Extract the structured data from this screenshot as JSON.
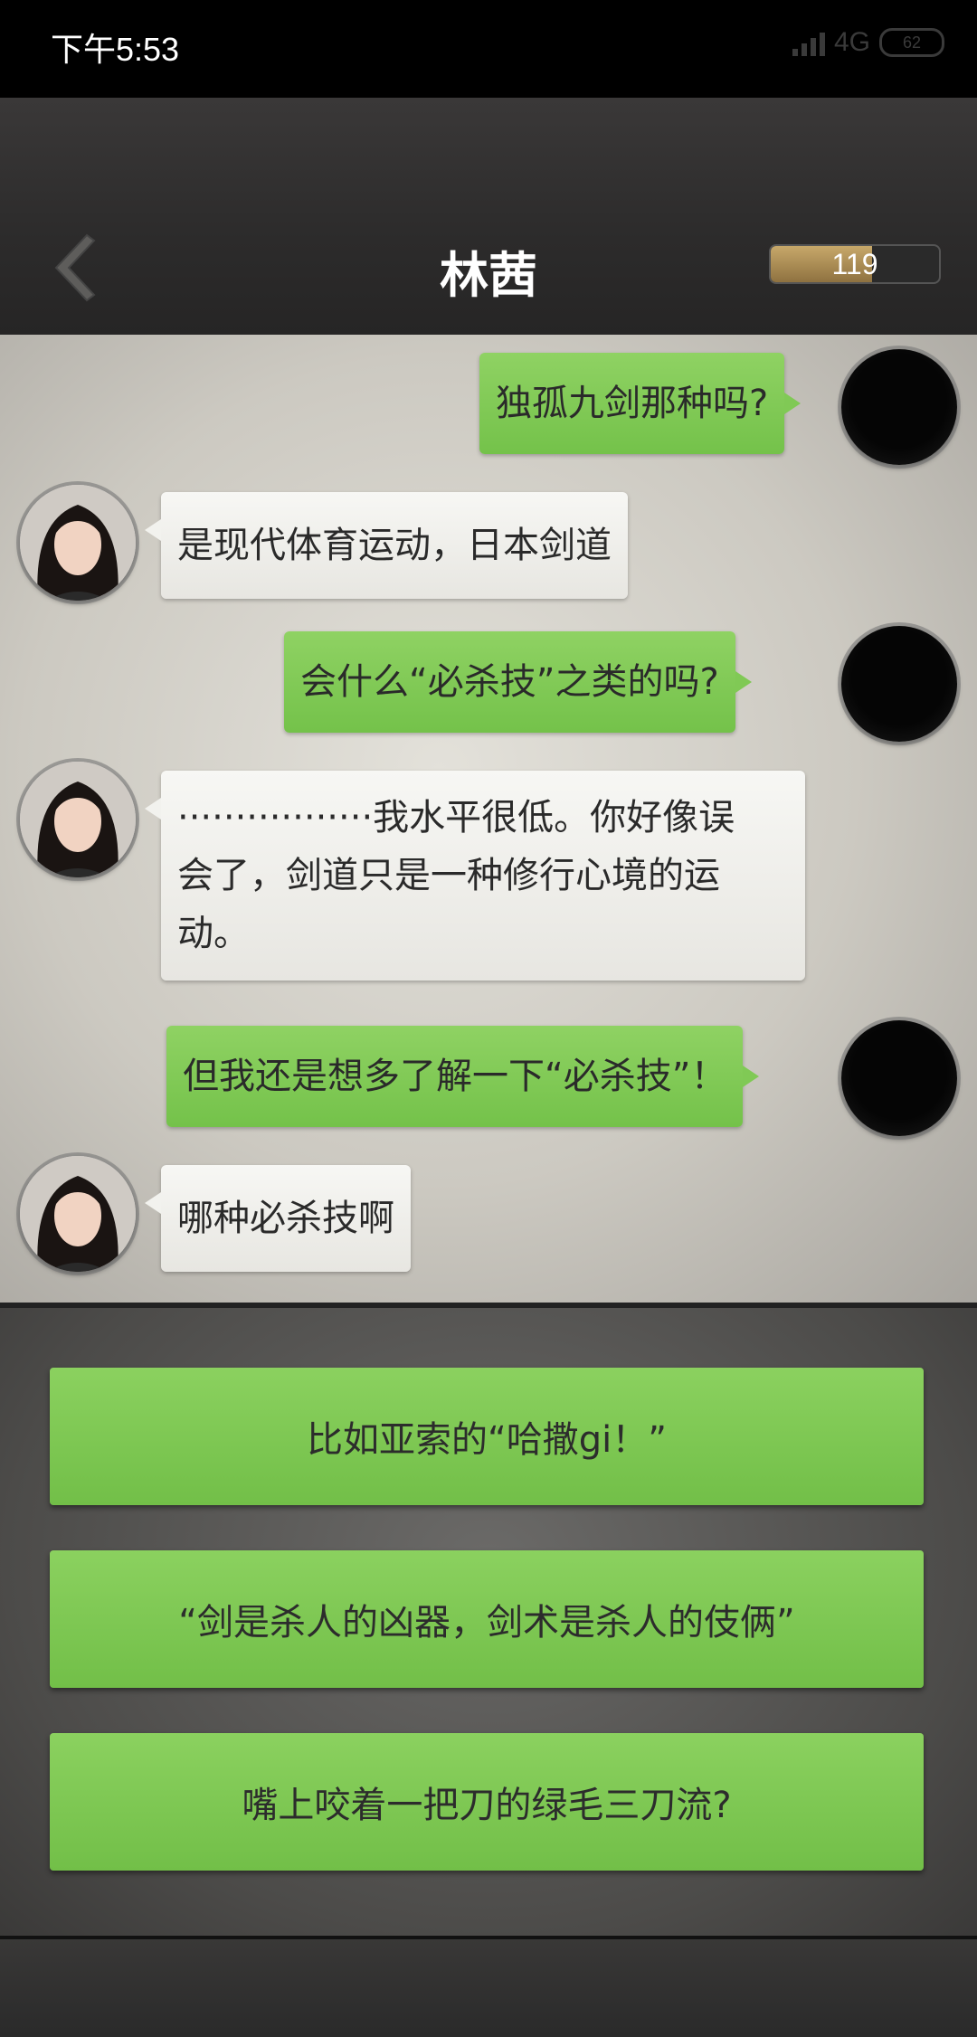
{
  "status_bar": {
    "time": "下午5:53",
    "network": "4G",
    "battery": "62"
  },
  "header": {
    "title": "林茜",
    "energy_value": "119",
    "energy_fill": 0.6
  },
  "chat": {
    "messages": [
      {
        "sender": "me",
        "text": "独孤九剑那种吗?"
      },
      {
        "sender": "her",
        "text": "是现代体育运动，日本剑道"
      },
      {
        "sender": "me",
        "text": "会什么“必杀技”之类的吗?"
      },
      {
        "sender": "her",
        "lines": [
          "·················我水平很低。你好像误",
          "会了，剑道只是一种修行心境的运",
          "动。"
        ]
      },
      {
        "sender": "me",
        "text": "但我还是想多了解一下“必杀技”！"
      },
      {
        "sender": "her",
        "text": "哪种必杀技啊"
      }
    ]
  },
  "options": [
    {
      "label": "比如亚索的“哈撒gi！”"
    },
    {
      "label": "“剑是杀人的凶器，剑术是杀人的伎俩”"
    },
    {
      "label": "嘴上咬着一把刀的绿毛三刀流?"
    }
  ],
  "colors": {
    "my_bubble": "#80c955",
    "her_bubble": "#f2f2ee",
    "option_button": "#7ec854"
  }
}
